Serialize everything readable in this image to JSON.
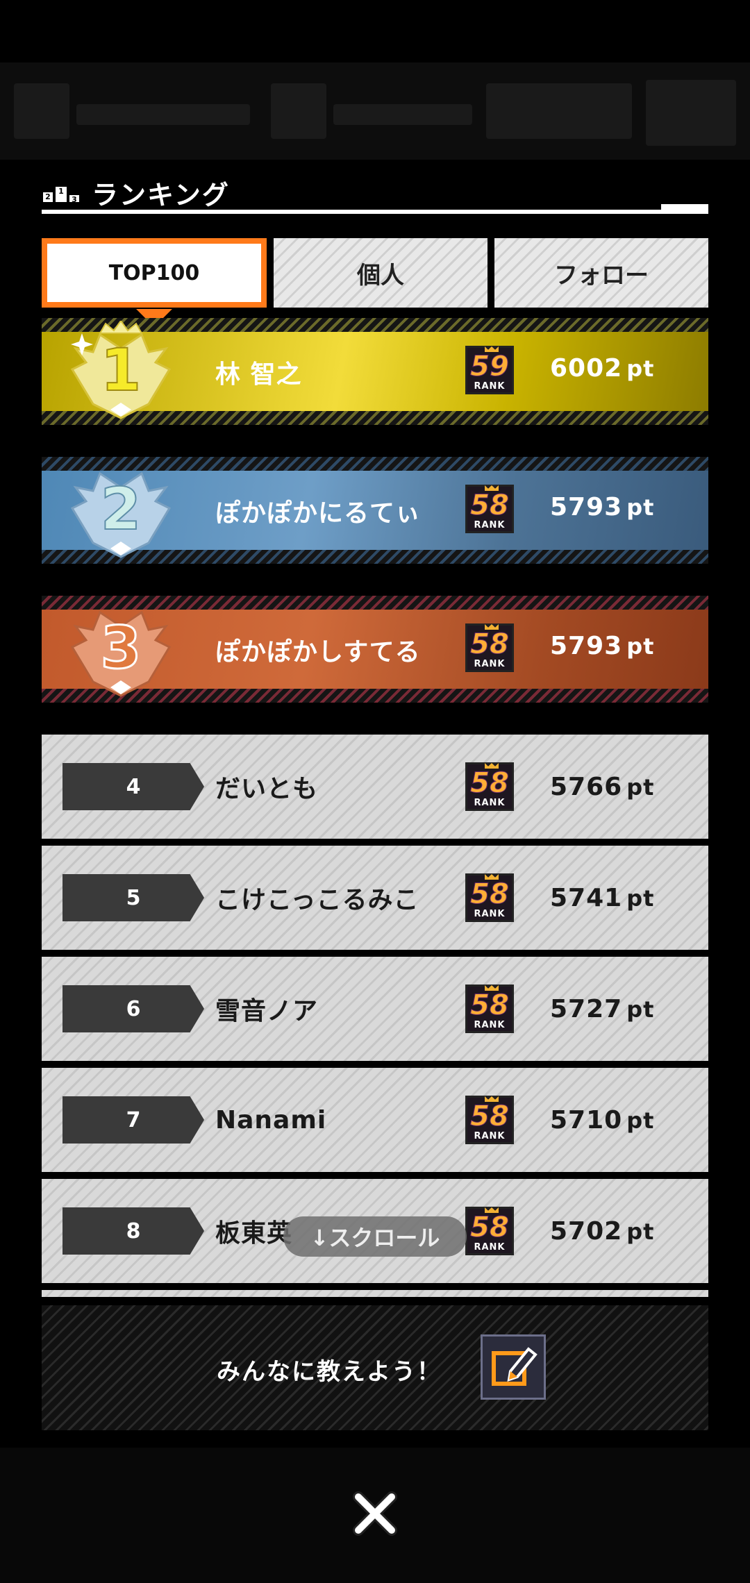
{
  "panel": {
    "title": "ランキング",
    "podium_labels": [
      "2",
      "1",
      "3"
    ]
  },
  "tabs": [
    {
      "label": "TOP100",
      "active": true
    },
    {
      "label": "個人",
      "active": false
    },
    {
      "label": "フォロー",
      "active": false
    }
  ],
  "ranking": [
    {
      "rank": "1",
      "name": "林 智之",
      "level": "59",
      "points": "6002",
      "unit": "pt"
    },
    {
      "rank": "2",
      "name": "ぽかぽかにるてぃ",
      "level": "58",
      "points": "5793",
      "unit": "pt"
    },
    {
      "rank": "3",
      "name": "ぽかぽかしすてる",
      "level": "58",
      "points": "5793",
      "unit": "pt"
    },
    {
      "rank": "4",
      "name": "だいとも",
      "level": "58",
      "points": "5766",
      "unit": "pt"
    },
    {
      "rank": "5",
      "name": "こけこっこるみこ",
      "level": "58",
      "points": "5741",
      "unit": "pt"
    },
    {
      "rank": "6",
      "name": "雪音ノア",
      "level": "58",
      "points": "5727",
      "unit": "pt"
    },
    {
      "rank": "7",
      "name": "Nanami",
      "level": "58",
      "points": "5710",
      "unit": "pt"
    },
    {
      "rank": "8",
      "name": "板東英",
      "level": "58",
      "points": "5702",
      "unit": "pt"
    }
  ],
  "badge_label": "RANK",
  "scroll_hint": "↓スクロール",
  "share_label": "みんなに教えよう！",
  "colors": {
    "accent": "#ff7a1a",
    "gold": "#f2dc3a",
    "silver": "#6e9ec7",
    "bronze": "#cf6a3a",
    "badge_number": "#ffae35"
  },
  "icons": {
    "podium": "podium-icon",
    "crown": "crown-icon",
    "share": "edit-share-icon",
    "close": "close-icon"
  }
}
